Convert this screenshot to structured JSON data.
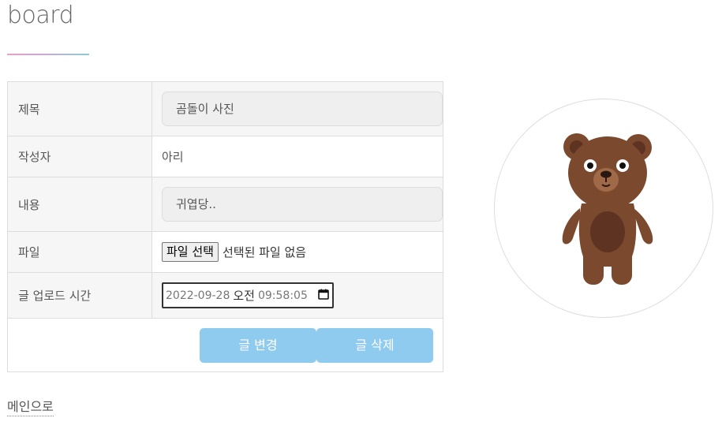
{
  "page": {
    "title": "board"
  },
  "form": {
    "rows": [
      {
        "label": "제목",
        "value": "곰돌이 사진"
      },
      {
        "label": "작성자",
        "value": "아리"
      },
      {
        "label": "내용",
        "value": "귀엽당.."
      },
      {
        "label": "파일",
        "file_button": "파일 선택",
        "file_status": "선택된 파일 없음"
      },
      {
        "label": "글 업로드 시간",
        "date": "2022-09-28",
        "ampm": "오전",
        "time": "09:58:05"
      }
    ]
  },
  "actions": {
    "edit_label": "글 변경",
    "delete_label": "글 삭제"
  },
  "nav": {
    "main_link": "메인으로"
  },
  "image": {
    "subject": "brown teddy bear illustration"
  },
  "colors": {
    "button": "#8fcbef",
    "label_bg": "#f6f6f6",
    "bear": "#7b4a2e"
  },
  "icons": {
    "calendar": "calendar-icon"
  }
}
